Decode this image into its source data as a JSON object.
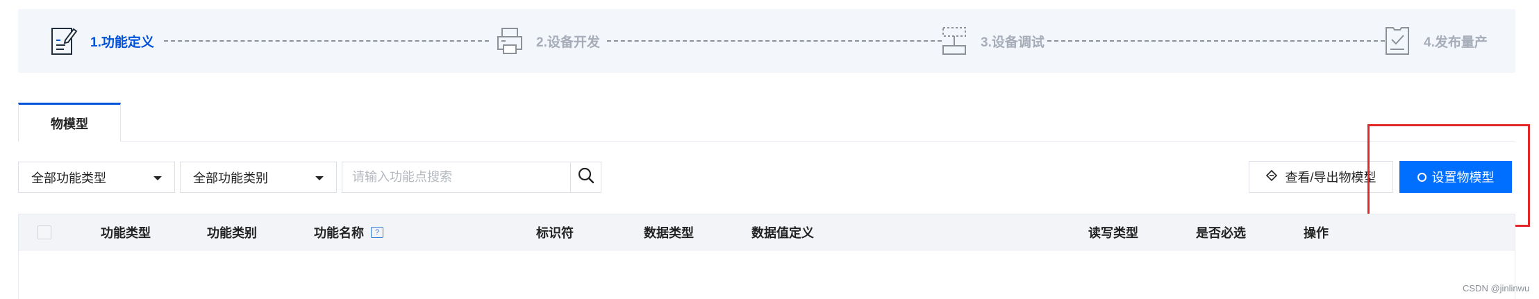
{
  "steps": [
    {
      "label": "1.功能定义",
      "icon": "document-edit-icon",
      "active": true
    },
    {
      "label": "2.设备开发",
      "icon": "printer-device-icon",
      "active": false
    },
    {
      "label": "3.设备调试",
      "icon": "debug-flow-icon",
      "active": false
    },
    {
      "label": "4.发布量产",
      "icon": "checklist-icon",
      "active": false
    }
  ],
  "tabs": [
    {
      "label": "物模型",
      "active": true
    }
  ],
  "filters": {
    "function_type": "全部功能类型",
    "function_category": "全部功能类别",
    "search_placeholder": "请输入功能点搜索"
  },
  "actions": {
    "view_export": "查看/导出物模型",
    "set_model": "设置物模型"
  },
  "table": {
    "columns": [
      "功能类型",
      "功能类别",
      "功能名称",
      "标识符",
      "数据类型",
      "数据值定义",
      "读写类型",
      "是否必选",
      "操作"
    ],
    "help_glyph": "?"
  },
  "watermark": "CSDN @jinlinwu",
  "colors": {
    "accent": "#0052d9",
    "primary_button": "#006eff",
    "highlight_box": "#e12727"
  }
}
